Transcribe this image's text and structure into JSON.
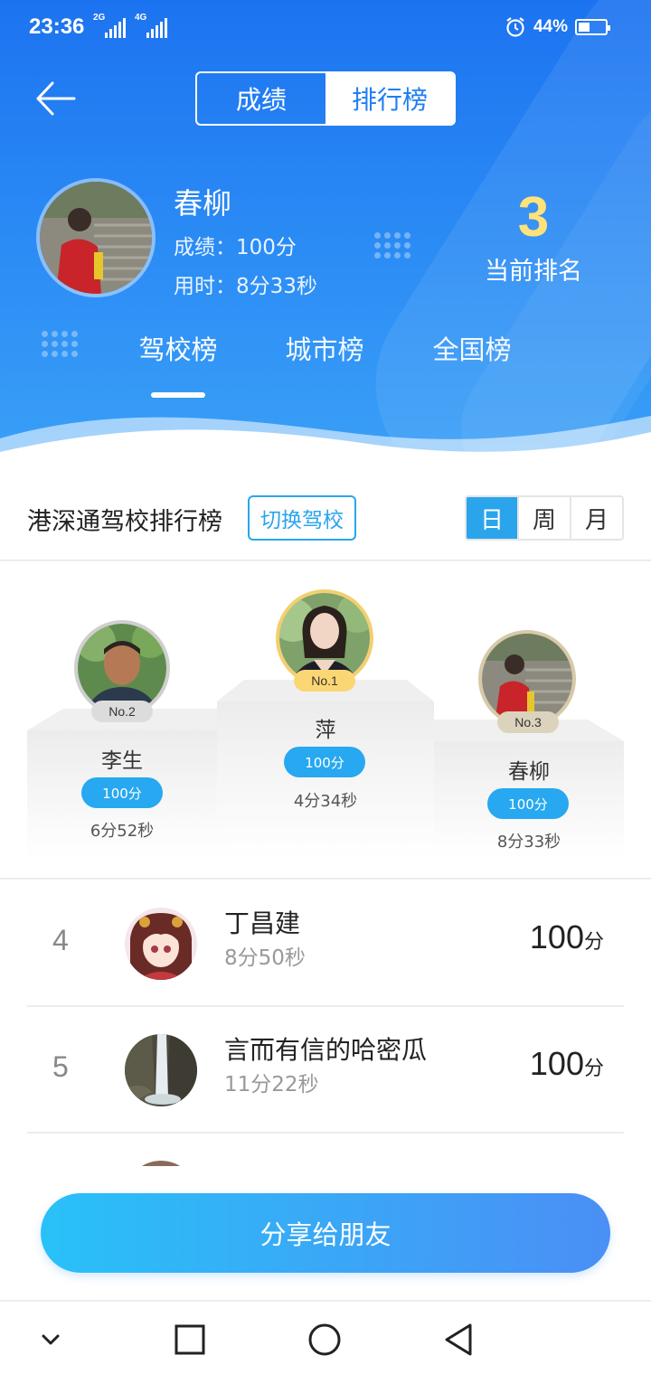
{
  "status_bar": {
    "time": "23:36",
    "net1": "2G",
    "net2": "4G",
    "battery": "44%",
    "battery_level": 0.44
  },
  "tabs": {
    "score": "成绩",
    "ranking": "排行榜"
  },
  "me": {
    "name": "春柳",
    "score_line": "成绩：100分",
    "time_line": "用时：8分33秒",
    "rank": "3",
    "rank_label": "当前排名"
  },
  "categories": [
    "驾校榜",
    "城市榜",
    "全国榜"
  ],
  "school": {
    "title": "港深通驾校排行榜",
    "switch_label": "切换驾校",
    "periods": [
      "日",
      "周",
      "月"
    ]
  },
  "podium": {
    "first": {
      "badge": "No.1",
      "name": "萍",
      "score": "100分",
      "time": "4分34秒"
    },
    "second": {
      "badge": "No.2",
      "name": "李生",
      "score": "100分",
      "time": "6分52秒"
    },
    "third": {
      "badge": "No.3",
      "name": "春柳",
      "score": "100分",
      "time": "8分33秒"
    }
  },
  "list": [
    {
      "rank": "4",
      "name": "丁昌建",
      "time": "8分50秒",
      "score": "100",
      "unit": "分"
    },
    {
      "rank": "5",
      "name": "言而有信的哈密瓜",
      "time": "11分22秒",
      "score": "100",
      "unit": "分"
    }
  ],
  "share_label": "分享给朋友",
  "colors": {
    "header": "#1c73f0",
    "accent": "#27a8f0",
    "gold": "#ffe27a"
  }
}
